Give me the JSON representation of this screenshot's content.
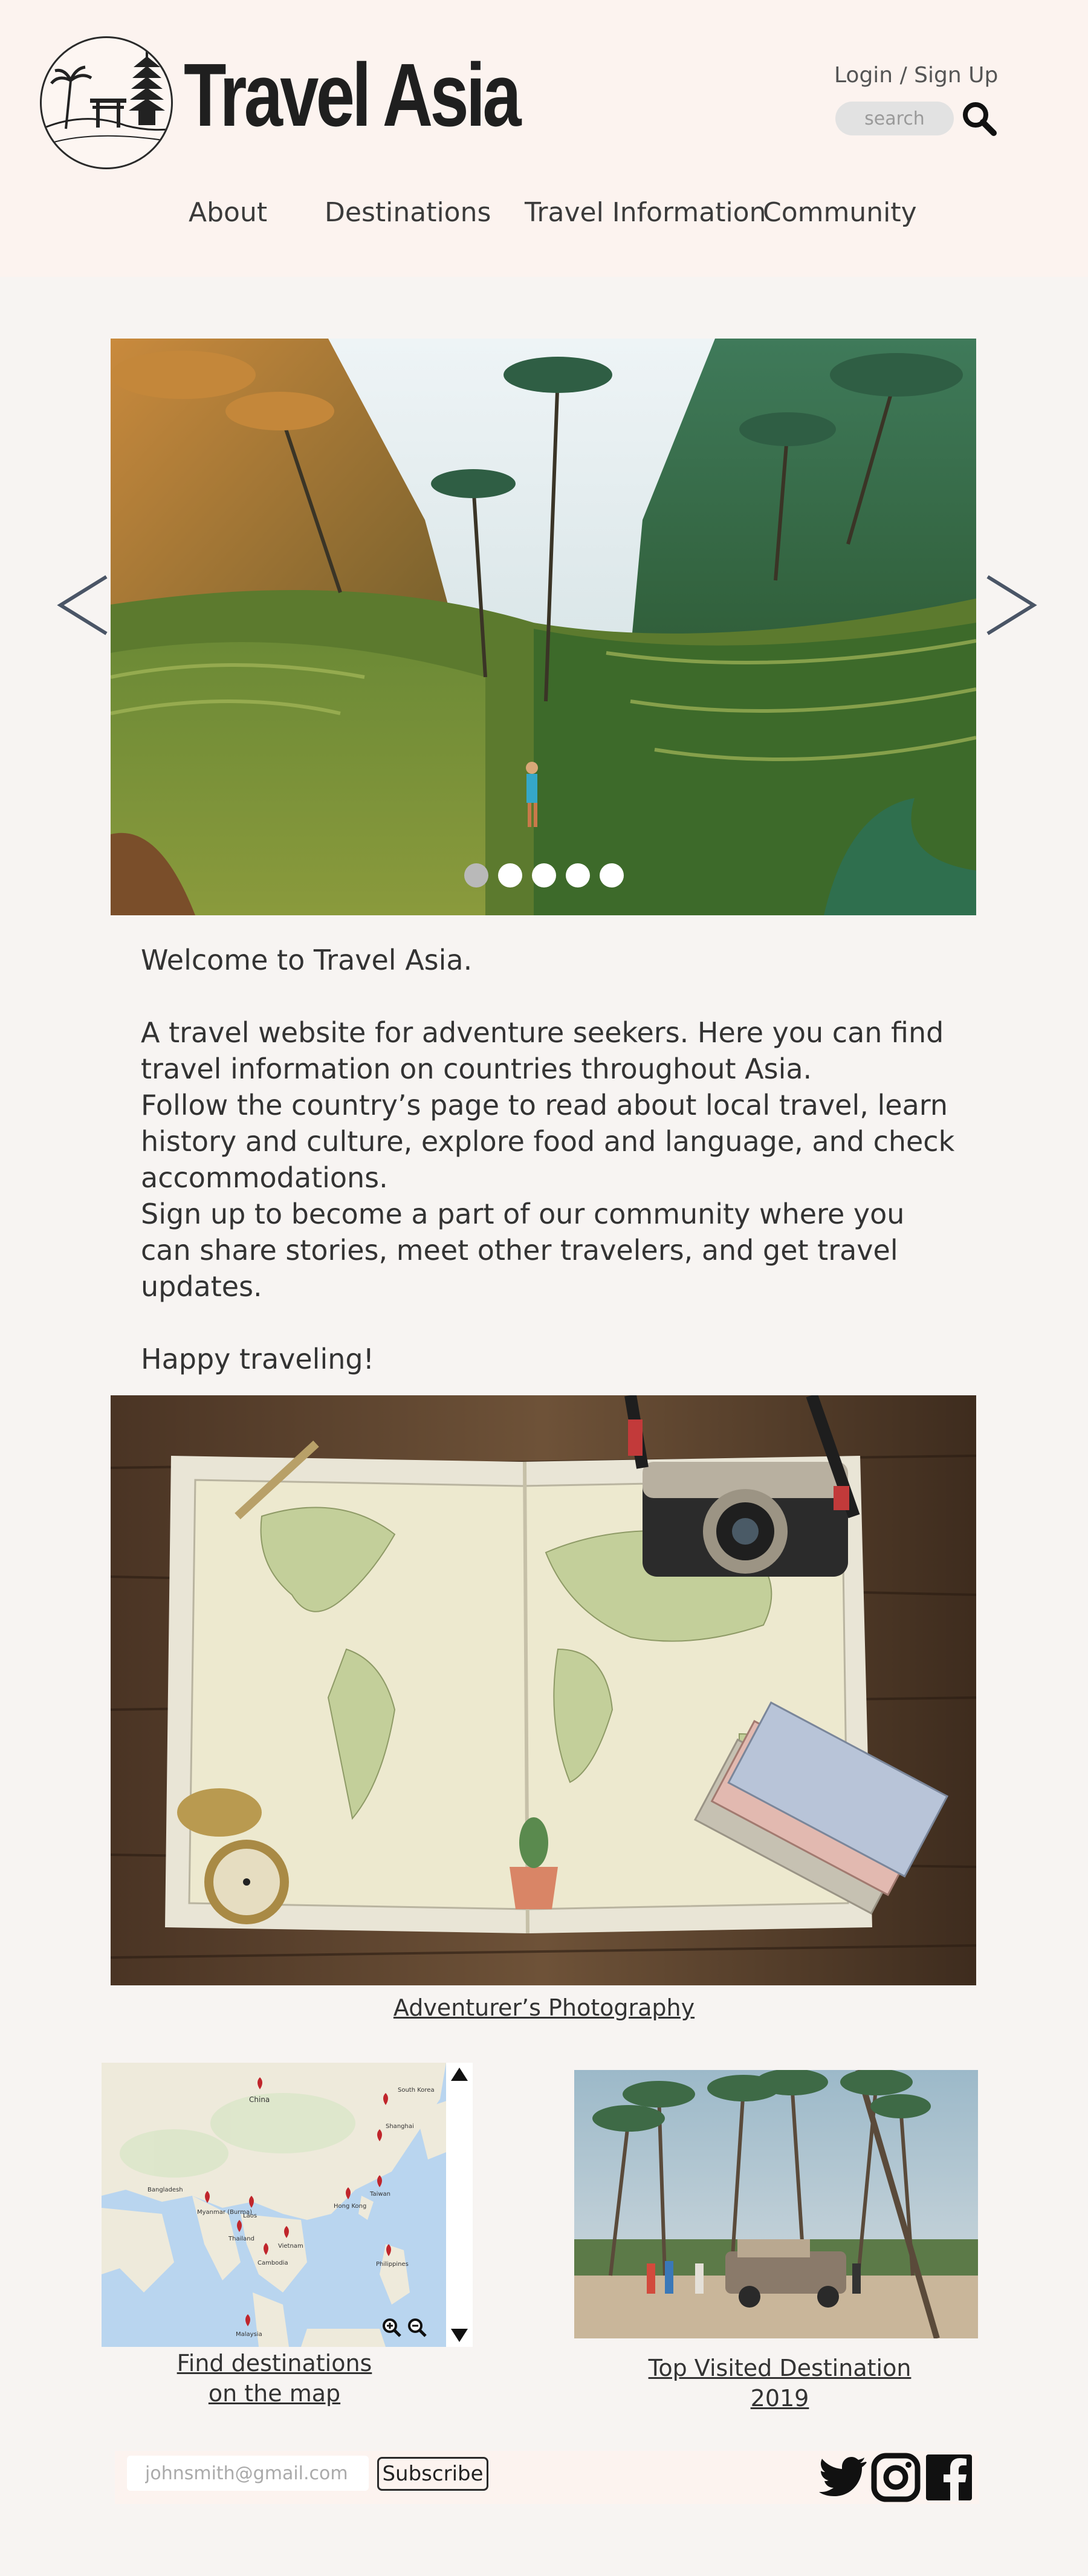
{
  "header": {
    "title": "Travel Asia",
    "login_label": "Login / Sign Up",
    "search_placeholder": "search",
    "logo_icon": "pagoda-torii-palm-logo",
    "search_icon": "magnifier-icon"
  },
  "nav": {
    "items": [
      {
        "label": "About"
      },
      {
        "label": "Destinations"
      },
      {
        "label": "Travel Information"
      },
      {
        "label": "Community"
      }
    ]
  },
  "carousel": {
    "image": "rice-terraces-with-hiker",
    "slide_count": 5,
    "active_index": 0,
    "prev_icon": "chevron-left-icon",
    "next_icon": "chevron-right-icon"
  },
  "welcome": {
    "heading": "Welcome to Travel Asia.",
    "paragraph1": "A travel website for adventure seekers. Here you can find travel information on countries throughout Asia.",
    "paragraph2": "Follow the country’s page to read about local travel, learn history and culture, explore food and language, and check accommodations.",
    "paragraph3": "Sign up to become a part of our community where you can share stories, meet other travelers, and get travel updates.",
    "closing": "Happy traveling!"
  },
  "photo": {
    "image": "world-map-camera-compass-banknotes",
    "caption": "Adventurer’s Photography"
  },
  "map_section": {
    "caption_line1": "Find destinations",
    "caption_line2": "on the map",
    "country_labels": [
      "China",
      "South Korea",
      "Shanghai",
      "Bangladesh",
      "Myanmar (Burma)",
      "Laos",
      "Thailand",
      "Vietnam",
      "Cambodia",
      "Taiwan",
      "Hong Kong",
      "Philippines",
      "Malaysia"
    ],
    "zoom_in_icon": "zoom-in-icon",
    "zoom_out_icon": "zoom-out-icon"
  },
  "top_visited": {
    "image": "palm-beach-vintage-jeep",
    "caption_line1": "Top Visited Destination",
    "caption_line2": "2019"
  },
  "footer": {
    "email_placeholder": "johnsmith@gmail.com",
    "subscribe_label": "Subscribe",
    "social_icons": [
      "twitter-icon",
      "instagram-icon",
      "facebook-icon"
    ]
  },
  "colors": {
    "header_bg": "#fcf3ef",
    "page_bg": "#f7f4f2",
    "text": "#2b2b2b",
    "arrow": "#4a5566"
  }
}
